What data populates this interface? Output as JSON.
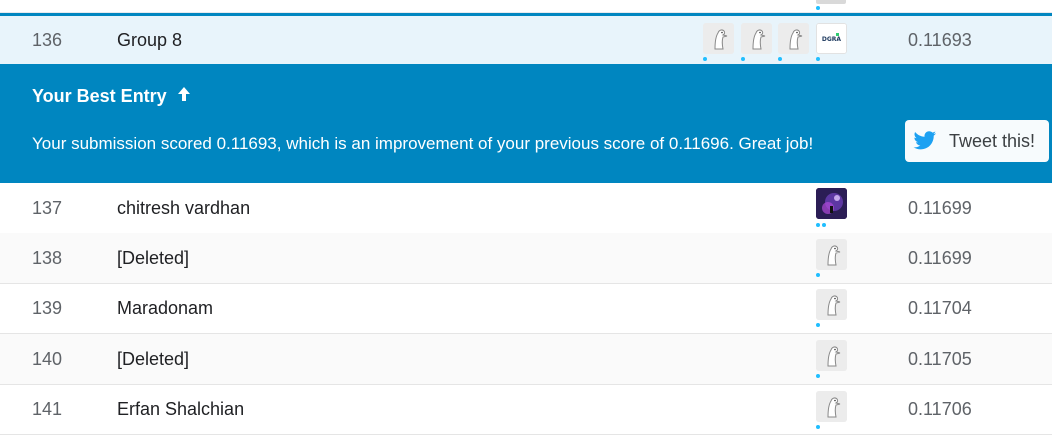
{
  "leaderboard": {
    "current": {
      "rank": "136",
      "team": "Group 8",
      "score": "0.11693",
      "logo_text": "DGRA"
    },
    "best_entry": {
      "title": "Your Best Entry",
      "message": "Your submission scored 0.11693, which is an improvement of your previous score of 0.11696. Great job!",
      "tweet_label": "Tweet this!"
    },
    "rows": [
      {
        "rank": "137",
        "team": "chitresh vardhan",
        "score": "0.11699"
      },
      {
        "rank": "138",
        "team": "[Deleted]",
        "score": "0.11699"
      },
      {
        "rank": "139",
        "team": "Maradonam",
        "score": "0.11704"
      },
      {
        "rank": "140",
        "team": "[Deleted]",
        "score": "0.11705"
      },
      {
        "rank": "141",
        "team": "Erfan Shalchian",
        "score": "0.11706"
      }
    ]
  },
  "colors": {
    "accent": "#0086c0",
    "highlight_row": "#e8f4fb",
    "twitter": "#1da1f2",
    "online_dot": "#20beff"
  },
  "icons": {
    "default_avatar": "goose-avatar-icon",
    "tweet": "twitter-bird-icon",
    "arrow": "arrow-up-icon"
  }
}
